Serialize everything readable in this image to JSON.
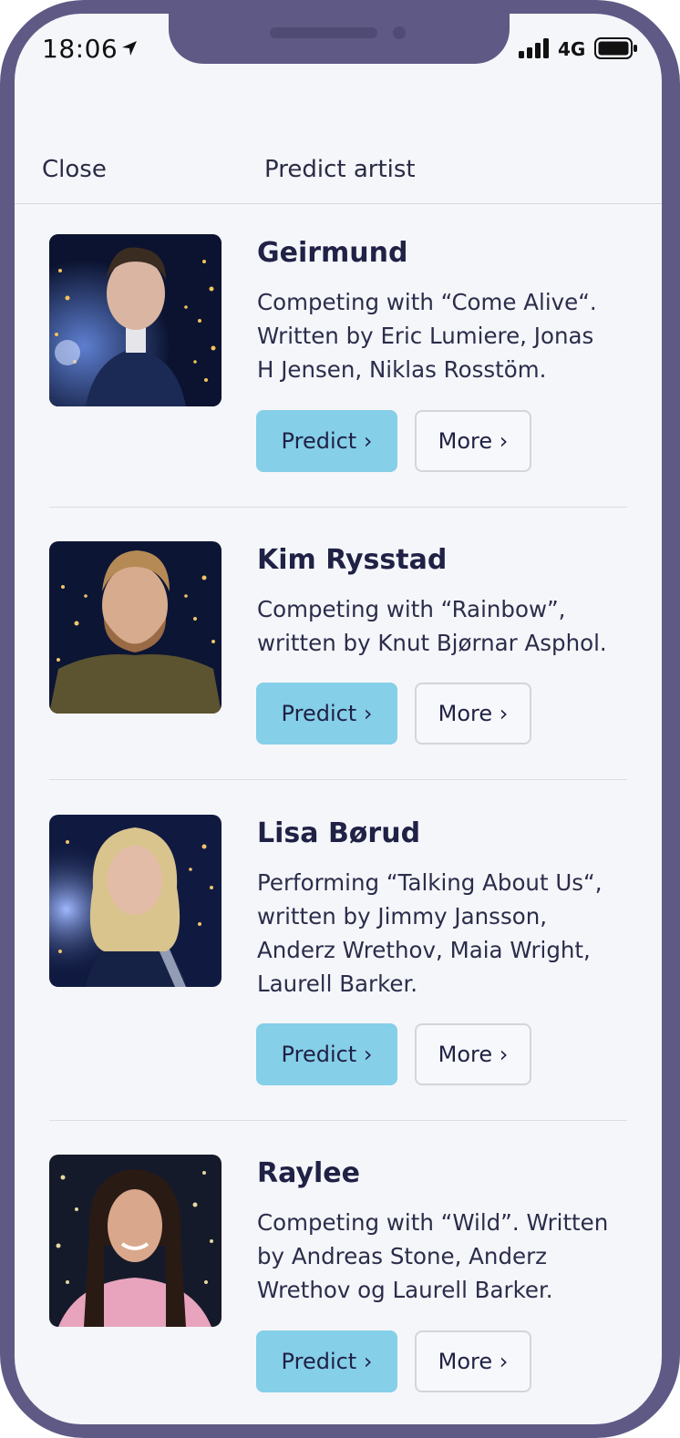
{
  "status_bar": {
    "time": "18:06",
    "network": "4G"
  },
  "header": {
    "close_label": "Close",
    "title": "Predict artist"
  },
  "colors": {
    "frame": "#5e5a85",
    "screen": "#f5f6fa",
    "predict_button": "#85cfe8",
    "text": "#1f2145"
  },
  "artists": [
    {
      "name": "Geirmund",
      "description": [
        "Competing with “Come Alive“.",
        "Written by Eric Lumiere, Jonas",
        "H Jensen, Niklas Rosstöm."
      ],
      "predict_label": "Predict ›",
      "more_label": "More ›"
    },
    {
      "name": "Kim Rysstad",
      "description": [
        "Competing with “Rainbow”,",
        "written by Knut Bjørnar Asphol."
      ],
      "predict_label": "Predict ›",
      "more_label": "More ›"
    },
    {
      "name": "Lisa Børud",
      "description": [
        "Performing “Talking About Us“,",
        "written by Jimmy Jansson,",
        "Anderz Wrethov, Maia Wright,",
        "Laurell Barker."
      ],
      "predict_label": "Predict ›",
      "more_label": "More ›"
    },
    {
      "name": "Raylee",
      "description": [
        "Competing with “Wild”. Written",
        "by Andreas Stone, Anderz",
        "Wrethov og Laurell Barker."
      ],
      "predict_label": "Predict ›",
      "more_label": "More ›"
    }
  ]
}
